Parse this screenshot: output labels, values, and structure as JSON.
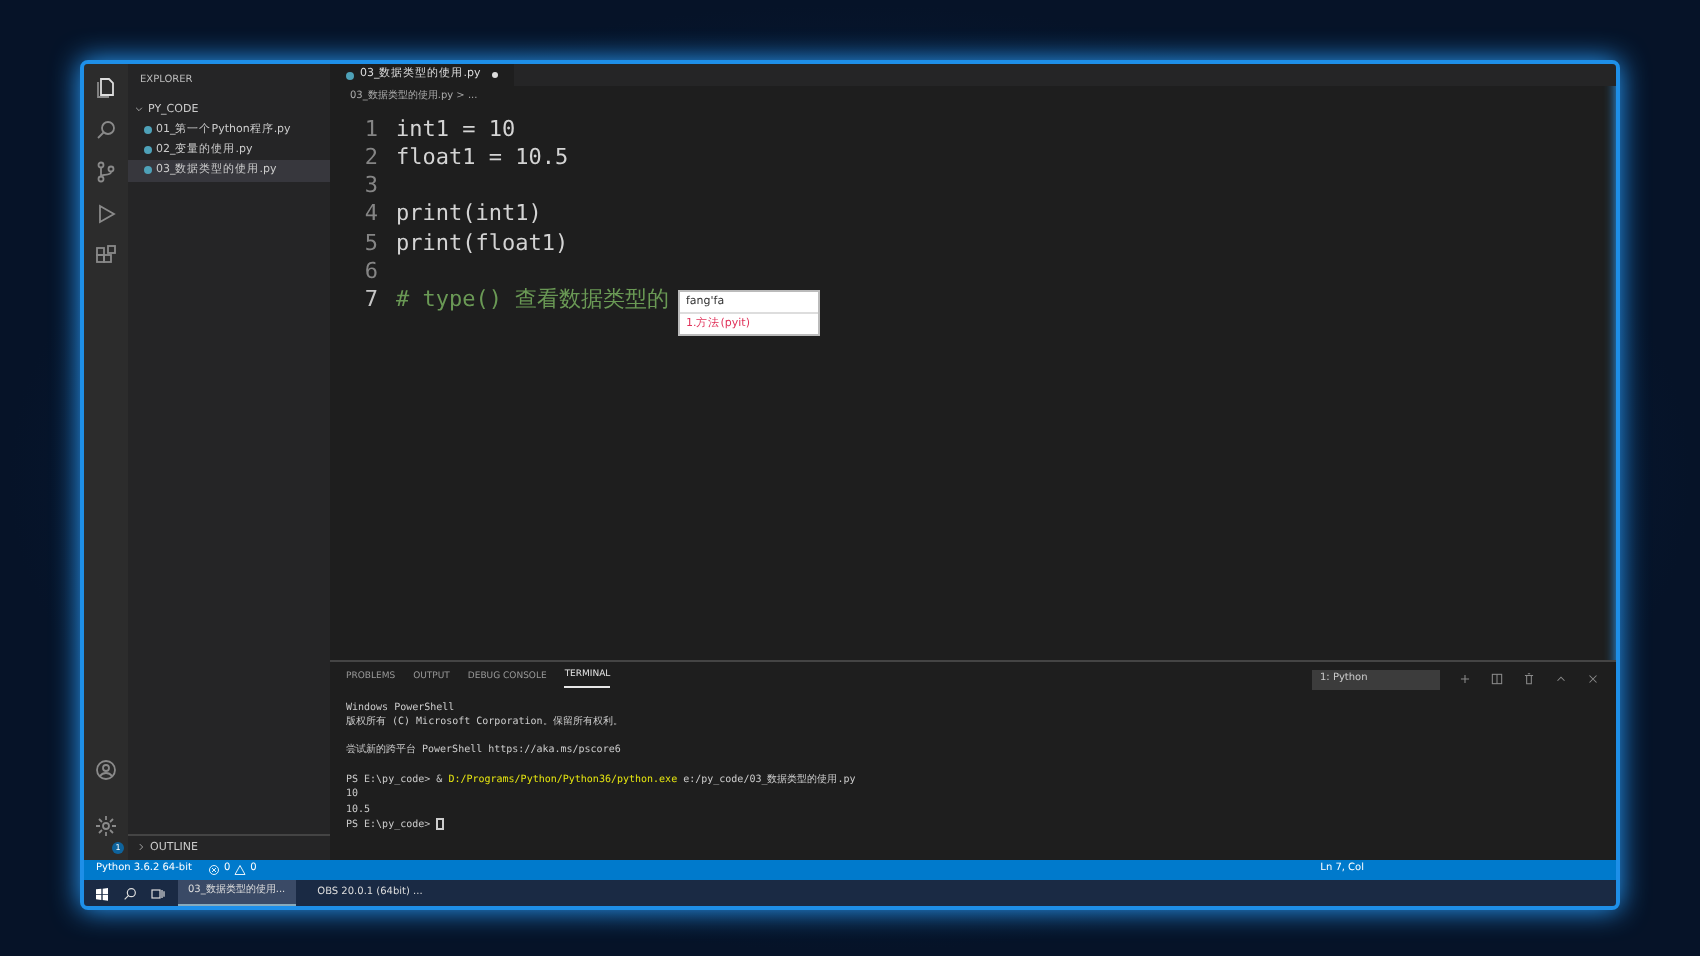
{
  "sidebar": {
    "title": "EXPLORER",
    "folder": {
      "label": "PY_CODE",
      "expanded": true,
      "files": [
        {
          "label": "01_第一个Python程序.py",
          "selected": false
        },
        {
          "label": "02_变量的使用.py",
          "selected": false
        },
        {
          "label": "03_数据类型的使用.py",
          "selected": true
        }
      ]
    },
    "outline": {
      "label": "OUTLINE",
      "expanded": false
    }
  },
  "activity_bar": {
    "badge": "1"
  },
  "editor": {
    "tab": {
      "label": "03_数据类型的使用.py",
      "modified": true
    },
    "breadcrumb": "03_数据类型的使用.py > ...",
    "lines": [
      {
        "number": "1",
        "text": "int1 = 10",
        "kind": "code",
        "current": false
      },
      {
        "number": "2",
        "text": "float1 = 10.5",
        "kind": "code",
        "current": false
      },
      {
        "number": "3",
        "kind": "code",
        "current": false
      },
      {
        "number": "4",
        "text": "print(int1)",
        "kind": "code",
        "current": false
      },
      {
        "number": "5",
        "text": "print(float1)",
        "kind": "code",
        "current": false
      },
      {
        "number": "6",
        "kind": "code",
        "current": false
      },
      {
        "number": "7",
        "text": "# type() 查看数据类型的",
        "kind": "comment",
        "current": true
      }
    ],
    "ime_popup": {
      "input": "fang'fa",
      "candidate": "1.方法(pyit)"
    }
  },
  "panel": {
    "tabs": [
      {
        "label": "PROBLEMS",
        "selected": false
      },
      {
        "label": "OUTPUT",
        "selected": false
      },
      {
        "label": "DEBUG CONSOLE",
        "selected": false
      },
      {
        "label": "TERMINAL",
        "selected": true
      }
    ],
    "terminal_select": "1: Python",
    "terminal_lines": [
      {
        "text": "Windows PowerShell"
      },
      {
        "text": "版权所有 (C) Microsoft Corporation。保留所有权利。"
      },
      {
        "text": "尝试新的跨平台 PowerShell https://aka.ms/pscore6",
        "gap_before": true
      },
      {
        "gap_before": true,
        "text": "PS E:\\py_code> & ",
        "highlight": "D:/Programs/Python/Python36/python.exe",
        "rest": " e:/py_code/03_数据类型的使用.py"
      },
      {
        "text": "10",
        "cursor": false
      },
      {
        "text": "10.5"
      },
      {
        "text": "PS E:\\py_code> ",
        "cursor": true
      }
    ]
  },
  "status_bar": {
    "interpreter": "Python 3.6.2 64-bit",
    "errors": "0",
    "warnings": "0",
    "position": "Ln 7, Col"
  },
  "taskbar": {
    "items": [
      {
        "label": "03_数据类型的使用...",
        "active": true
      },
      {
        "label": "OBS 20.0.1 (64bit) ...",
        "active": false
      }
    ]
  }
}
